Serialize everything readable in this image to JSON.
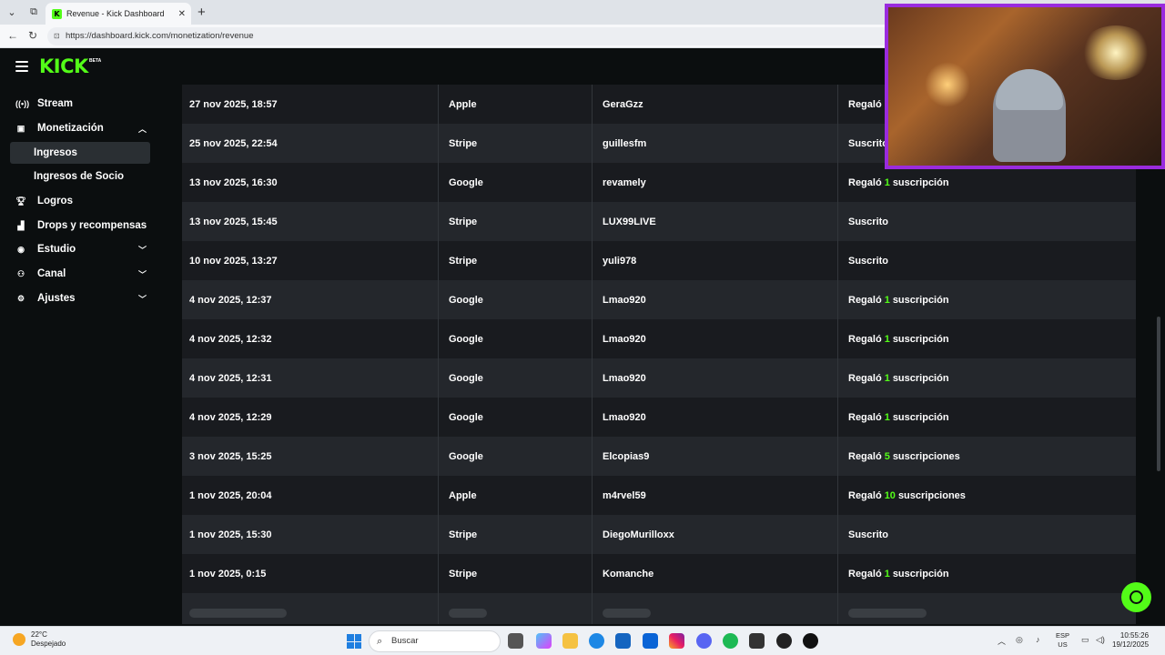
{
  "browser": {
    "tab_title": "Revenue - Kick Dashboard",
    "favicon_letter": "K",
    "url": "https://dashboard.kick.com/monetization/revenue"
  },
  "app": {
    "logo": "KICK",
    "badge": "BETA",
    "accent_color": "#53fc18"
  },
  "sidebar": {
    "items": [
      {
        "label": "Stream",
        "icon": "broadcast-icon"
      },
      {
        "label": "Monetización",
        "icon": "money-icon"
      },
      {
        "label": "Ingresos",
        "icon": ""
      },
      {
        "label": "Ingresos de Socio",
        "icon": ""
      },
      {
        "label": "Logros",
        "icon": "trophy-icon"
      },
      {
        "label": "Drops y recompensas",
        "icon": "chart-icon"
      },
      {
        "label": "Estudio",
        "icon": "camera-icon"
      },
      {
        "label": "Canal",
        "icon": "users-icon"
      },
      {
        "label": "Ajustes",
        "icon": "gear-icon"
      }
    ]
  },
  "table": {
    "rows": [
      {
        "date": "27 nov 2025, 18:57",
        "method": "Apple",
        "user": "GeraGzz",
        "pre": "Regaló",
        "num": "",
        "post": ""
      },
      {
        "date": "25 nov 2025, 22:54",
        "method": "Stripe",
        "user": "guillesfm",
        "pre": "Suscrito",
        "num": "",
        "post": ""
      },
      {
        "date": "13 nov 2025, 16:30",
        "method": "Google",
        "user": "revamely",
        "pre": "Regaló",
        "num": "1",
        "post": "suscripción"
      },
      {
        "date": "13 nov 2025, 15:45",
        "method": "Stripe",
        "user": "LUX99LIVE",
        "pre": "Suscrito",
        "num": "",
        "post": ""
      },
      {
        "date": "10 nov 2025, 13:27",
        "method": "Stripe",
        "user": "yuli978",
        "pre": "Suscrito",
        "num": "",
        "post": ""
      },
      {
        "date": "4 nov 2025, 12:37",
        "method": "Google",
        "user": "Lmao920",
        "pre": "Regaló",
        "num": "1",
        "post": "suscripción"
      },
      {
        "date": "4 nov 2025, 12:32",
        "method": "Google",
        "user": "Lmao920",
        "pre": "Regaló",
        "num": "1",
        "post": "suscripción"
      },
      {
        "date": "4 nov 2025, 12:31",
        "method": "Google",
        "user": "Lmao920",
        "pre": "Regaló",
        "num": "1",
        "post": "suscripción"
      },
      {
        "date": "4 nov 2025, 12:29",
        "method": "Google",
        "user": "Lmao920",
        "pre": "Regaló",
        "num": "1",
        "post": "suscripción"
      },
      {
        "date": "3 nov 2025, 15:25",
        "method": "Google",
        "user": "Elcopias9",
        "pre": "Regaló",
        "num": "5",
        "post": "suscripciones"
      },
      {
        "date": "1 nov 2025, 20:04",
        "method": "Apple",
        "user": "m4rvel59",
        "pre": "Regaló",
        "num": "10",
        "post": "suscripciones"
      },
      {
        "date": "1 nov 2025, 15:30",
        "method": "Stripe",
        "user": "DiegoMurilloxx",
        "pre": "Suscrito",
        "num": "",
        "post": ""
      },
      {
        "date": "1 nov 2025, 0:15",
        "method": "Stripe",
        "user": "Komanche",
        "pre": "Regaló",
        "num": "1",
        "post": "suscripción"
      }
    ]
  },
  "taskbar": {
    "temperature": "22°C",
    "weather": "Despejado",
    "search_placeholder": "Buscar",
    "lang_top": "ESP",
    "lang_bottom": "US",
    "time": "10:55:26",
    "date": "19/12/2025"
  }
}
